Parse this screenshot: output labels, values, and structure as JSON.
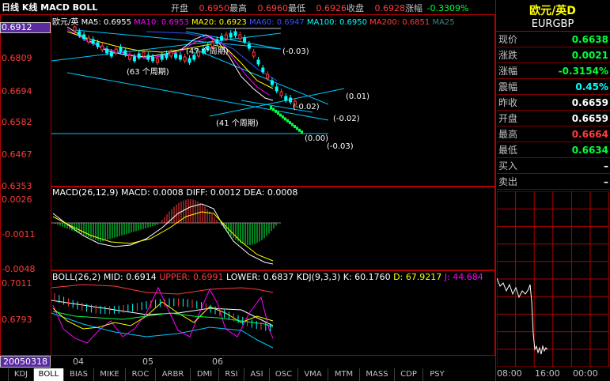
{
  "title": "日线 K线 MACD BOLL",
  "quote_bar": {
    "open_label": "开盘",
    "open": "0.6950",
    "high_label": "最高",
    "high": "0.6960",
    "low_label": "最低",
    "low": "0.6926",
    "close_label": "收盘",
    "close": "0.6928",
    "change_label": "涨幅",
    "change": "-0.3309%"
  },
  "main_chart": {
    "legend_symbol": "欧元/英",
    "ma5": "MA5: 0.6955",
    "ma10": "MA10: 0.6953",
    "ma20": "MA20: 0.6923",
    "ma60": "MA60: 0.6947",
    "ma100": "MA100: 0.6950",
    "ma200": "MA200: 0.6851",
    "ma25": "MA25",
    "y_ticks": [
      "0.6912",
      "0.6809",
      "0.6694",
      "0.6582",
      "0.6467",
      "0.6353"
    ],
    "annotations": {
      "p47": "(47 个周期)",
      "p63": "(63 个周期)",
      "p41": "(41 个周期)",
      "a1": "(-0.03)",
      "a2": "(0.01)",
      "a3": "(-0.02)",
      "a4": "(-0.02)",
      "a5": "(0.00)",
      "a6": "(-0.03)"
    }
  },
  "macd_chart": {
    "title": "MACD(26,12,9)",
    "macd": "MACD: 0.0008",
    "diff": "DIFF: 0.0012",
    "dea": "DEA: 0.0008",
    "y_ticks": [
      "0.0026",
      "-0.0011",
      "-0.0048"
    ]
  },
  "boll_chart": {
    "title": "BOLL(26,2)",
    "mid": "MID: 0.6914",
    "upper": "UPPER: 0.6991",
    "lower": "LOWER: 0.6837",
    "kdj": "KDJ(9,3,3)",
    "k": "K: 60.1760",
    "d": "D: 67.9217",
    "j": "J: 44.684",
    "y_ticks": [
      "0.7011",
      "0.6793"
    ]
  },
  "x_axis": {
    "date_box": "20050318",
    "months": [
      "04",
      "05",
      "06"
    ]
  },
  "tabs": [
    "KDJ",
    "BOLL",
    "BIAS",
    "MIKE",
    "ROC",
    "ARBR",
    "DMI",
    "RSI",
    "ASI",
    "OSC",
    "VMA",
    "MTM",
    "MASS",
    "CDP",
    "PSY"
  ],
  "active_tab": "BOLL",
  "info_panel": {
    "name": "欧元/英Ⅾ",
    "code": "EURGBP",
    "rows": [
      {
        "label": "现价",
        "value": "0.6638",
        "color": "#00ff3c"
      },
      {
        "label": "涨跌",
        "value": "0.0021",
        "color": "#00ff3c"
      },
      {
        "label": "涨幅",
        "value": "-0.3154%",
        "color": "#00ff3c"
      },
      {
        "label": "震幅",
        "value": "0.45%",
        "color": "#00ffff"
      },
      {
        "label": "昨收",
        "value": "0.6659",
        "color": "#ffffff"
      },
      {
        "label": "开盘",
        "value": "0.6659",
        "color": "#ffffff"
      },
      {
        "label": "最高",
        "value": "0.6664",
        "color": "#ff3c3c"
      },
      {
        "label": "最低",
        "value": "0.6634",
        "color": "#00ff3c"
      },
      {
        "label": "买入",
        "value": "–",
        "color": "#ffffff"
      },
      {
        "label": "卖出",
        "value": "–",
        "color": "#ffffff"
      }
    ],
    "mini_times": [
      "08:00",
      "16:00",
      "00:00"
    ]
  },
  "colors": {
    "up": "#ff3c3c",
    "down": "#00ff3c",
    "grid": "#b00000",
    "bg": "#000000"
  }
}
